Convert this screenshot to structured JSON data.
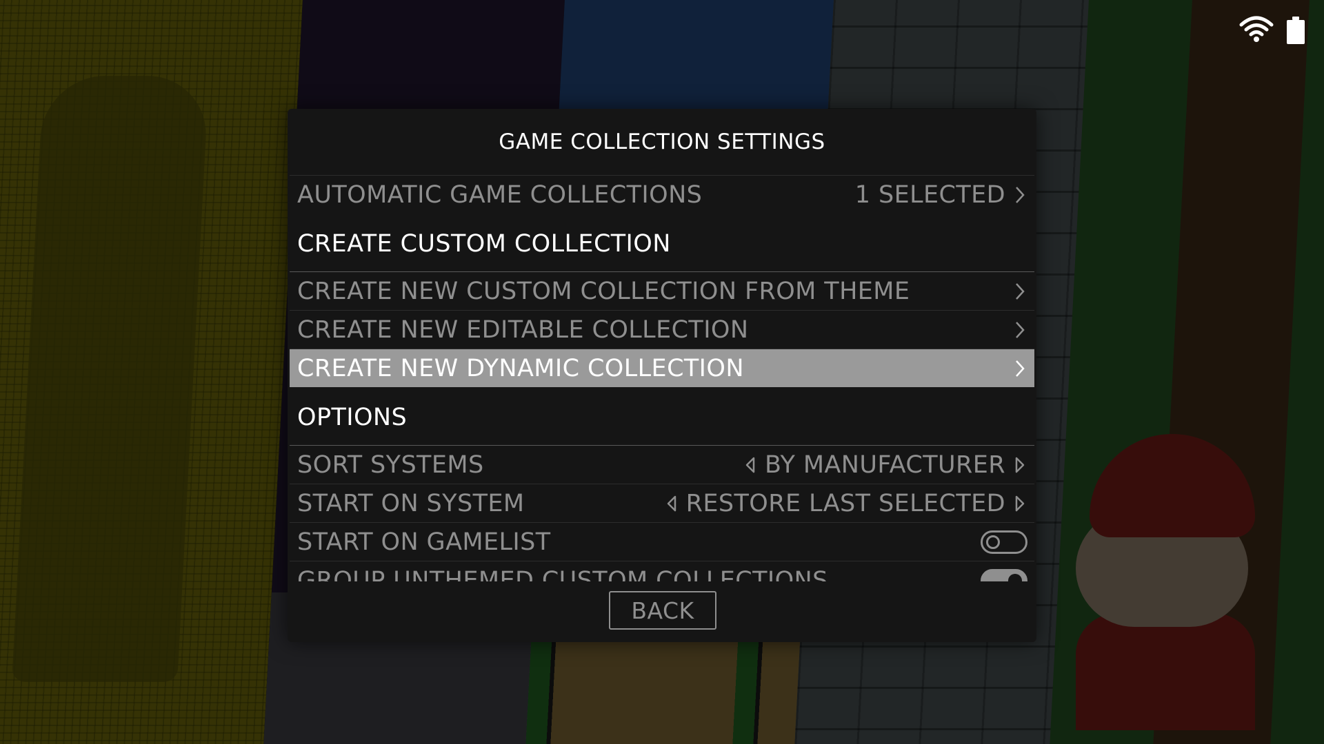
{
  "status": {
    "wifi_icon": "wifi-icon",
    "battery_icon": "battery-icon"
  },
  "menu": {
    "title": "GAME COLLECTION SETTINGS",
    "automatic": {
      "label": "AUTOMATIC GAME COLLECTIONS",
      "value": "1 SELECTED"
    },
    "header_custom": "CREATE CUSTOM COLLECTION",
    "from_theme": {
      "label": "CREATE NEW CUSTOM COLLECTION FROM THEME"
    },
    "editable": {
      "label": "CREATE NEW EDITABLE COLLECTION"
    },
    "dynamic": {
      "label": "CREATE NEW DYNAMIC COLLECTION"
    },
    "header_options": "OPTIONS",
    "sort_systems": {
      "label": "SORT SYSTEMS",
      "value": "BY MANUFACTURER"
    },
    "start_on_system": {
      "label": "START ON SYSTEM",
      "value": "RESTORE LAST SELECTED"
    },
    "start_on_gamelist": {
      "label": "START ON GAMELIST",
      "enabled": false
    },
    "group_unthemed": {
      "label": "GROUP UNTHEMED CUSTOM COLLECTIONS",
      "enabled": true
    },
    "back_label": "BACK"
  },
  "colors": {
    "panel": "#151515",
    "selected_row": "#9a9a9a",
    "text_dim": "#8f8f8f",
    "text_bright": "#ffffff"
  }
}
